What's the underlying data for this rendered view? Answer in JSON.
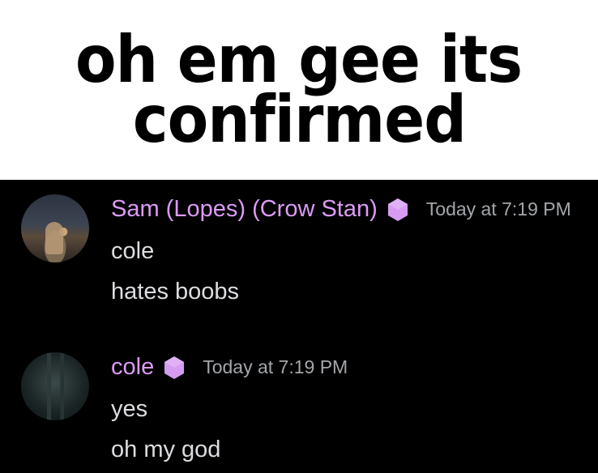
{
  "caption": {
    "line1": "oh em gee its",
    "line2": "confirmed"
  },
  "colors": {
    "chat_background": "#000000",
    "username": "#dc9bf4",
    "timestamp": "#a3a6aa",
    "message_text": "#dcdde0",
    "badge": "#d69cf2"
  },
  "messages": [
    {
      "username": "Sam (Lopes) (Crow Stan)",
      "badge_icon": "purple-gem-icon",
      "timestamp": "Today at 7:19 PM",
      "lines": [
        "cole",
        "hates boobs"
      ]
    },
    {
      "username": "cole",
      "badge_icon": "purple-gem-icon",
      "timestamp": "Today at 7:19 PM",
      "lines": [
        "yes",
        "oh my god"
      ]
    }
  ]
}
